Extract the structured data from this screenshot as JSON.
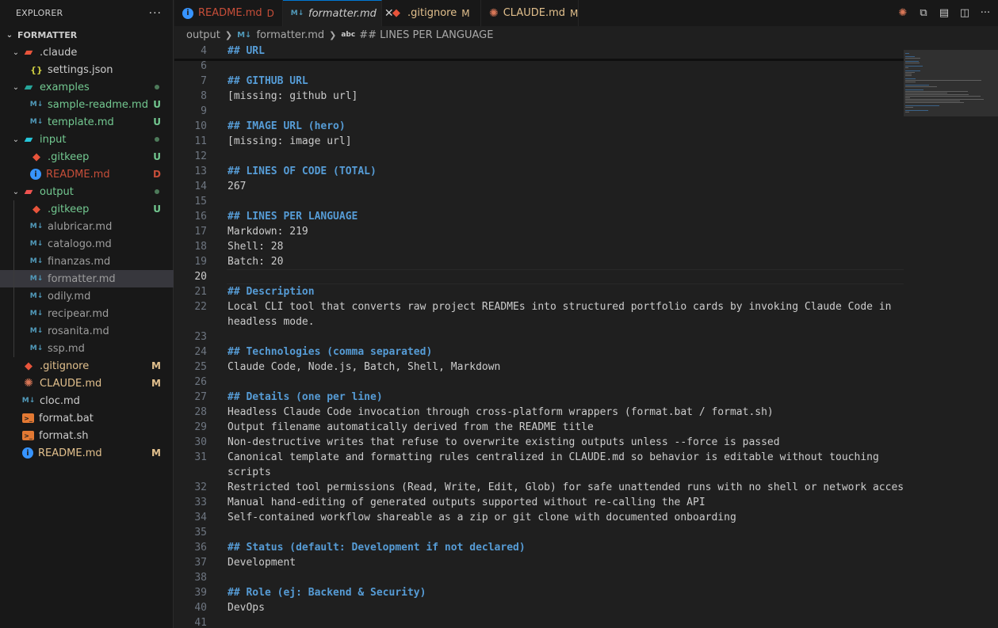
{
  "explorer": {
    "title": "EXPLORER",
    "more": "···",
    "root": "FORMATTER",
    "items": [
      {
        "label": ".claude",
        "kind": "folder",
        "icon": "folder-claude-icon",
        "depth": 1,
        "chevron": "⌄",
        "color": "#cccccc",
        "status": "",
        "dot": false
      },
      {
        "label": "settings.json",
        "kind": "json",
        "icon": "json-icon",
        "depth": 2,
        "chevron": "",
        "color": "#cccccc",
        "status": "",
        "dot": false
      },
      {
        "label": "examples",
        "kind": "folder",
        "icon": "folder-examples-icon",
        "depth": 1,
        "chevron": "⌄",
        "color": "#73c991",
        "status": "",
        "dot": true
      },
      {
        "label": "sample-readme.md",
        "kind": "md",
        "icon": "markdown-icon",
        "depth": 2,
        "chevron": "",
        "color": "#73c991",
        "status": "U",
        "dot": false
      },
      {
        "label": "template.md",
        "kind": "md",
        "icon": "markdown-icon",
        "depth": 2,
        "chevron": "",
        "color": "#73c991",
        "status": "U",
        "dot": false
      },
      {
        "label": "input",
        "kind": "folder",
        "icon": "folder-input-icon",
        "depth": 1,
        "chevron": "⌄",
        "color": "#73c991",
        "status": "",
        "dot": true
      },
      {
        "label": ".gitkeep",
        "kind": "git",
        "icon": "git-icon",
        "depth": 2,
        "chevron": "",
        "color": "#73c991",
        "status": "U",
        "dot": false
      },
      {
        "label": "README.md",
        "kind": "info",
        "icon": "info-icon",
        "depth": 2,
        "chevron": "",
        "color": "#c74e39",
        "status": "D",
        "dot": false
      },
      {
        "label": "output",
        "kind": "folder",
        "icon": "folder-output-icon",
        "depth": 1,
        "chevron": "⌄",
        "color": "#73c991",
        "status": "",
        "dot": true
      },
      {
        "label": ".gitkeep",
        "kind": "git",
        "icon": "git-icon",
        "depth": 2,
        "chevron": "",
        "color": "#73c991",
        "status": "U",
        "dot": false
      },
      {
        "label": "alubricar.md",
        "kind": "md",
        "icon": "markdown-icon",
        "depth": 2,
        "chevron": "",
        "color": "#9d9d9d",
        "status": "",
        "dot": false
      },
      {
        "label": "catalogo.md",
        "kind": "md",
        "icon": "markdown-icon",
        "depth": 2,
        "chevron": "",
        "color": "#9d9d9d",
        "status": "",
        "dot": false
      },
      {
        "label": "finanzas.md",
        "kind": "md",
        "icon": "markdown-icon",
        "depth": 2,
        "chevron": "",
        "color": "#9d9d9d",
        "status": "",
        "dot": false
      },
      {
        "label": "formatter.md",
        "kind": "md",
        "icon": "markdown-icon",
        "depth": 2,
        "chevron": "",
        "color": "#9d9d9d",
        "status": "",
        "dot": false,
        "selected": true
      },
      {
        "label": "odily.md",
        "kind": "md",
        "icon": "markdown-icon",
        "depth": 2,
        "chevron": "",
        "color": "#9d9d9d",
        "status": "",
        "dot": false
      },
      {
        "label": "recipear.md",
        "kind": "md",
        "icon": "markdown-icon",
        "depth": 2,
        "chevron": "",
        "color": "#9d9d9d",
        "status": "",
        "dot": false
      },
      {
        "label": "rosanita.md",
        "kind": "md",
        "icon": "markdown-icon",
        "depth": 2,
        "chevron": "",
        "color": "#9d9d9d",
        "status": "",
        "dot": false
      },
      {
        "label": "ssp.md",
        "kind": "md",
        "icon": "markdown-icon",
        "depth": 2,
        "chevron": "",
        "color": "#9d9d9d",
        "status": "",
        "dot": false
      },
      {
        "label": ".gitignore",
        "kind": "git",
        "icon": "git-icon",
        "depth": 1,
        "chevron": "",
        "color": "#e2c08d",
        "status": "M",
        "dot": false
      },
      {
        "label": "CLAUDE.md",
        "kind": "claude",
        "icon": "claude-icon",
        "depth": 1,
        "chevron": "",
        "color": "#e2c08d",
        "status": "M",
        "dot": false
      },
      {
        "label": "cloc.md",
        "kind": "md",
        "icon": "markdown-icon",
        "depth": 1,
        "chevron": "",
        "color": "#cccccc",
        "status": "",
        "dot": false
      },
      {
        "label": "format.bat",
        "kind": "terminal",
        "icon": "terminal-icon",
        "depth": 1,
        "chevron": "",
        "color": "#cccccc",
        "status": "",
        "dot": false
      },
      {
        "label": "format.sh",
        "kind": "terminal",
        "icon": "terminal-icon",
        "depth": 1,
        "chevron": "",
        "color": "#cccccc",
        "status": "",
        "dot": false
      },
      {
        "label": "README.md",
        "kind": "info",
        "icon": "info-icon",
        "depth": 1,
        "chevron": "",
        "color": "#e2c08d",
        "status": "M",
        "dot": false
      }
    ]
  },
  "tabs": [
    {
      "label": "README.md",
      "kind": "info",
      "icon": "info-icon",
      "status": "D",
      "color": "#c74e39",
      "active": false,
      "italic": false
    },
    {
      "label": "formatter.md",
      "kind": "md",
      "icon": "markdown-icon",
      "status": "",
      "color": "#cccccc",
      "active": true,
      "italic": true,
      "close": "✕"
    },
    {
      "label": ".gitignore",
      "kind": "git",
      "icon": "git-icon",
      "status": "M",
      "color": "#e2c08d",
      "active": false,
      "italic": false
    },
    {
      "label": "CLAUDE.md",
      "kind": "claude",
      "icon": "claude-icon",
      "status": "M",
      "color": "#e2c08d",
      "active": false,
      "italic": false
    }
  ],
  "tab_actions": [
    {
      "name": "claude-code-icon",
      "glyph": "✺",
      "color": "#d97757"
    },
    {
      "name": "compare-changes-icon",
      "glyph": "⧉",
      "color": "#cccccc"
    },
    {
      "name": "open-preview-icon",
      "glyph": "▤",
      "color": "#cccccc"
    },
    {
      "name": "split-editor-icon",
      "glyph": "◫",
      "color": "#cccccc"
    },
    {
      "name": "more-actions-icon",
      "glyph": "···",
      "color": "#cccccc"
    }
  ],
  "breadcrumb": {
    "folder": "output",
    "file": "formatter.md",
    "symbol_icon": "abc",
    "symbol": "## LINES PER LANGUAGE"
  },
  "editor": {
    "current_line": "20",
    "lines": [
      {
        "n": "4",
        "text": "## URL",
        "h": true
      },
      {
        "n": "6",
        "text": "",
        "h": false
      },
      {
        "n": "7",
        "text": "## GITHUB URL",
        "h": true
      },
      {
        "n": "8",
        "text": "[missing: github url]",
        "h": false
      },
      {
        "n": "9",
        "text": "",
        "h": false
      },
      {
        "n": "10",
        "text": "## IMAGE URL (hero)",
        "h": true
      },
      {
        "n": "11",
        "text": "[missing: image url]",
        "h": false
      },
      {
        "n": "12",
        "text": "",
        "h": false
      },
      {
        "n": "13",
        "text": "## LINES OF CODE (TOTAL)",
        "h": true
      },
      {
        "n": "14",
        "text": "267",
        "h": false
      },
      {
        "n": "15",
        "text": "",
        "h": false
      },
      {
        "n": "16",
        "text": "## LINES PER LANGUAGE",
        "h": true
      },
      {
        "n": "17",
        "text": "Markdown: 219",
        "h": false
      },
      {
        "n": "18",
        "text": "Shell: 28",
        "h": false
      },
      {
        "n": "19",
        "text": "Batch: 20",
        "h": false
      },
      {
        "n": "20",
        "text": "",
        "h": false
      },
      {
        "n": "21",
        "text": "## Description",
        "h": true
      },
      {
        "n": "22",
        "text": "Local CLI tool that converts raw project READMEs into structured portfolio cards by invoking Claude Code in",
        "h": false
      },
      {
        "n": "",
        "text": "headless mode.",
        "h": false
      },
      {
        "n": "23",
        "text": "",
        "h": false
      },
      {
        "n": "24",
        "text": "## Technologies (comma separated)",
        "h": true
      },
      {
        "n": "25",
        "text": "Claude Code, Node.js, Batch, Shell, Markdown",
        "h": false
      },
      {
        "n": "26",
        "text": "",
        "h": false
      },
      {
        "n": "27",
        "text": "## Details (one per line)",
        "h": true
      },
      {
        "n": "28",
        "text": "Headless Claude Code invocation through cross-platform wrappers (format.bat / format.sh)",
        "h": false
      },
      {
        "n": "29",
        "text": "Output filename automatically derived from the README title",
        "h": false
      },
      {
        "n": "30",
        "text": "Non-destructive writes that refuse to overwrite existing outputs unless --force is passed",
        "h": false
      },
      {
        "n": "31",
        "text": "Canonical template and formatting rules centralized in CLAUDE.md so behavior is editable without touching",
        "h": false
      },
      {
        "n": "",
        "text": "scripts",
        "h": false
      },
      {
        "n": "32",
        "text": "Restricted tool permissions (Read, Write, Edit, Glob) for safe unattended runs with no shell or network access",
        "h": false
      },
      {
        "n": "33",
        "text": "Manual hand-editing of generated outputs supported without re-calling the API",
        "h": false
      },
      {
        "n": "34",
        "text": "Self-contained workflow shareable as a zip or git clone with documented onboarding",
        "h": false
      },
      {
        "n": "35",
        "text": "",
        "h": false
      },
      {
        "n": "36",
        "text": "## Status (default: Development if not declared)",
        "h": true
      },
      {
        "n": "37",
        "text": "Development",
        "h": false
      },
      {
        "n": "38",
        "text": "",
        "h": false
      },
      {
        "n": "39",
        "text": "## Role (ej: Backend & Security)",
        "h": true
      },
      {
        "n": "40",
        "text": "DevOps",
        "h": false
      },
      {
        "n": "41",
        "text": "",
        "h": false
      }
    ]
  }
}
